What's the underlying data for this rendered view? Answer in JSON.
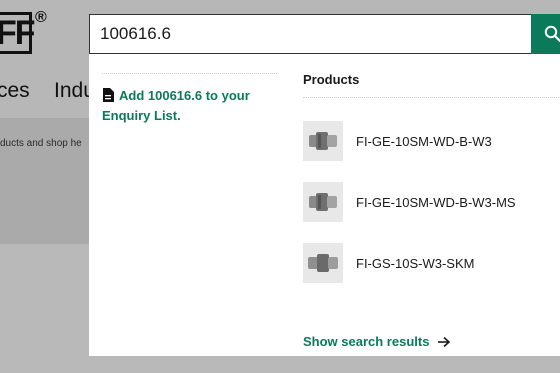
{
  "site": {
    "logo_text": "FF",
    "logo_reg": "®",
    "nav": [
      "ces",
      "Indu"
    ],
    "subtext": "ducts and shop he"
  },
  "search": {
    "value": "100616.6",
    "button_icon": "search-icon"
  },
  "dropdown": {
    "enquiry_link": "Add 100616.6 to your Enquiry List.",
    "products_heading": "Products",
    "products": [
      {
        "name": "FI-GE-10SM-WD-B-W3"
      },
      {
        "name": "FI-GE-10SM-WD-B-W3-MS"
      },
      {
        "name": "FI-GS-10S-W3-SKM"
      }
    ],
    "show_results": "Show search results"
  },
  "colors": {
    "accent": "#0b7a5a",
    "overlay": "#b9b9b9"
  }
}
